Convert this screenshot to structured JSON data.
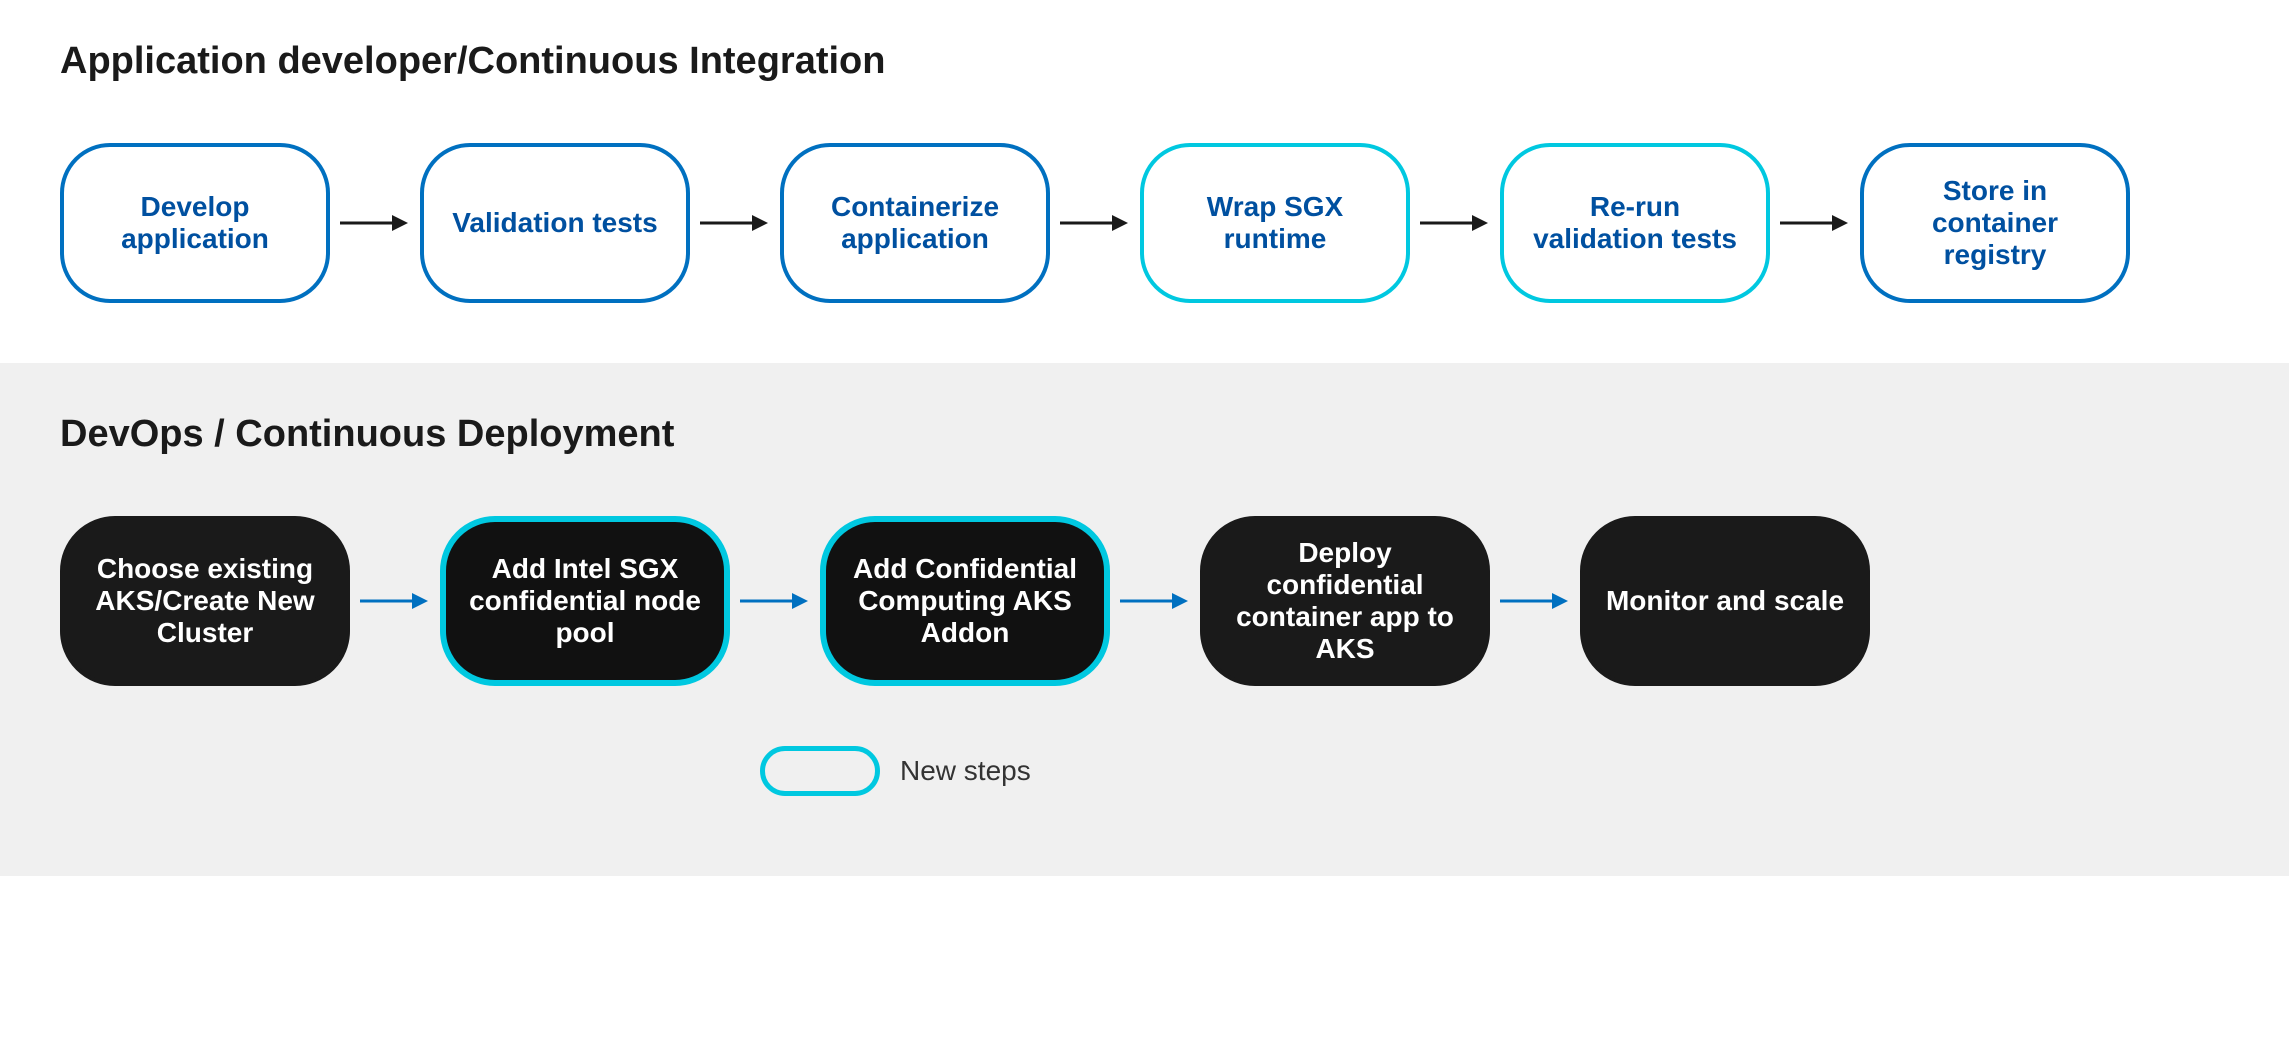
{
  "top_section": {
    "title": "Application developer/Continuous Integration",
    "nodes": [
      {
        "id": "develop",
        "label": "Develop application",
        "style": "light",
        "cyan": false
      },
      {
        "id": "validation",
        "label": "Validation tests",
        "style": "light",
        "cyan": false
      },
      {
        "id": "containerize",
        "label": "Containerize application",
        "style": "light",
        "cyan": false
      },
      {
        "id": "wrap-sgx",
        "label": "Wrap SGX runtime",
        "style": "light",
        "cyan": true
      },
      {
        "id": "rerun",
        "label": "Re-run validation tests",
        "style": "light",
        "cyan": true
      },
      {
        "id": "store",
        "label": "Store in container registry",
        "style": "light",
        "cyan": false
      }
    ]
  },
  "bottom_section": {
    "title": "DevOps / Continuous Deployment",
    "nodes": [
      {
        "id": "choose-aks",
        "label": "Choose existing AKS/Create New Cluster",
        "style": "dark",
        "cyan": false
      },
      {
        "id": "add-sgx",
        "label": "Add Intel SGX confidential node pool",
        "style": "dark",
        "cyan": true
      },
      {
        "id": "add-addon",
        "label": "Add Confidential Computing AKS Addon",
        "style": "dark",
        "cyan": true
      },
      {
        "id": "deploy",
        "label": "Deploy confidential container app to AKS",
        "style": "dark",
        "cyan": false
      },
      {
        "id": "monitor",
        "label": "Monitor and scale",
        "style": "dark",
        "cyan": false
      }
    ]
  },
  "legend": {
    "label": "New steps"
  }
}
